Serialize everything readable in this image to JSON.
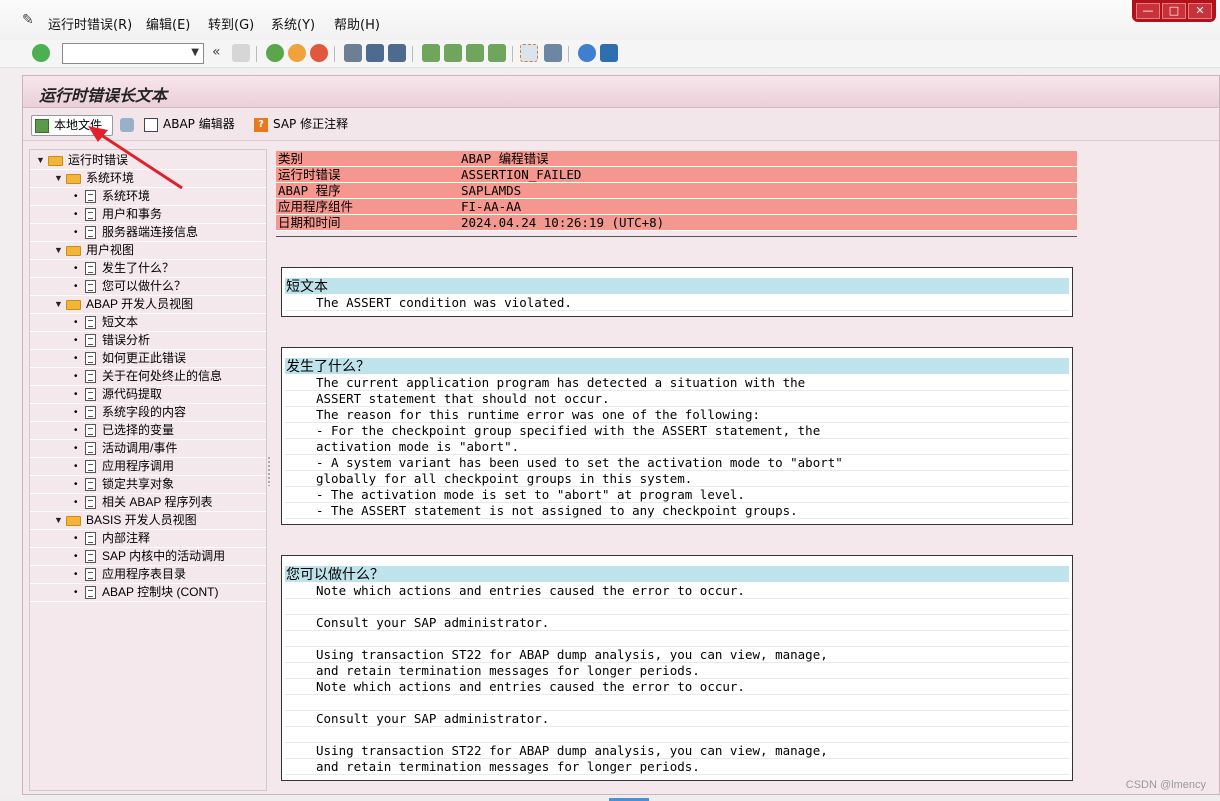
{
  "menu": {
    "items": [
      "运行时错误(R)",
      "编辑(E)",
      "转到(G)",
      "系统(Y)",
      "帮助(H)"
    ]
  },
  "window_controls": {
    "minimize": "—",
    "maximize": "□",
    "close": "✕"
  },
  "toolbar": {
    "command_field_value": "",
    "back_glyph": "«"
  },
  "title": "运行时错误长文本",
  "app_toolbar": {
    "local_file": "本地文件",
    "abap_editor": "ABAP 编辑器",
    "sap_note": "SAP 修正注释"
  },
  "tree": {
    "root": "运行时错误",
    "groups": [
      {
        "label": "系统环境",
        "items": [
          "系统环境",
          "用户和事务",
          "服务器端连接信息"
        ]
      },
      {
        "label": "用户视图",
        "items": [
          "发生了什么？",
          "您可以做什么？"
        ]
      },
      {
        "label": "ABAP 开发人员视图",
        "items": [
          "短文本",
          "错误分析",
          "如何更正此错误",
          "关于在何处终止的信息",
          "源代码提取",
          "系统字段的内容",
          "已选择的变量",
          "活动调用/事件",
          "应用程序调用",
          "锁定共享对象",
          "相关 ABAP 程序列表"
        ]
      },
      {
        "label": "BASIS 开发人员视图",
        "items": [
          "内部注释",
          "SAP 内核中的活动调用",
          "应用程序表目录",
          "ABAP 控制块 (CONT)"
        ]
      }
    ]
  },
  "header": [
    {
      "key": "类别",
      "value": "ABAP 编程错误"
    },
    {
      "key": "运行时错误",
      "value": "ASSERTION_FAILED"
    },
    {
      "key": "ABAP 程序",
      "value": "SAPLAMDS"
    },
    {
      "key": "应用程序组件",
      "value": "FI-AA-AA"
    },
    {
      "key": "日期和时间",
      "value": "2024.04.24 10:26:19 (UTC+8)"
    }
  ],
  "sections": [
    {
      "title": "短文本",
      "lines": [
        "The ASSERT condition was violated."
      ]
    },
    {
      "title": "发生了什么？",
      "lines": [
        "The current application program has detected a situation with the",
        "ASSERT statement that should not occur.",
        "The reason for this runtime error was one of the following:",
        "- For the checkpoint group specified with the ASSERT statement, the",
        "activation mode is \"abort\".",
        "- A system variant has been used to set the activation mode to \"abort\"",
        "globally for all checkpoint groups in this system.",
        "- The activation mode is set to \"abort\" at program level.",
        "- The ASSERT statement is not assigned to any checkpoint groups."
      ]
    },
    {
      "title": "您可以做什么？",
      "lines": [
        "Note which actions and entries caused the error to occur.",
        "",
        "Consult your SAP administrator.",
        "",
        "Using transaction ST22 for ABAP dump analysis, you can view, manage,",
        "and retain termination messages for longer periods.",
        "Note which actions and entries caused the error to occur.",
        "",
        "Consult your SAP administrator.",
        "",
        "Using transaction ST22 for ABAP dump analysis, you can view, manage,",
        "and retain termination messages for longer periods."
      ]
    }
  ],
  "watermark": "CSDN @lmency"
}
